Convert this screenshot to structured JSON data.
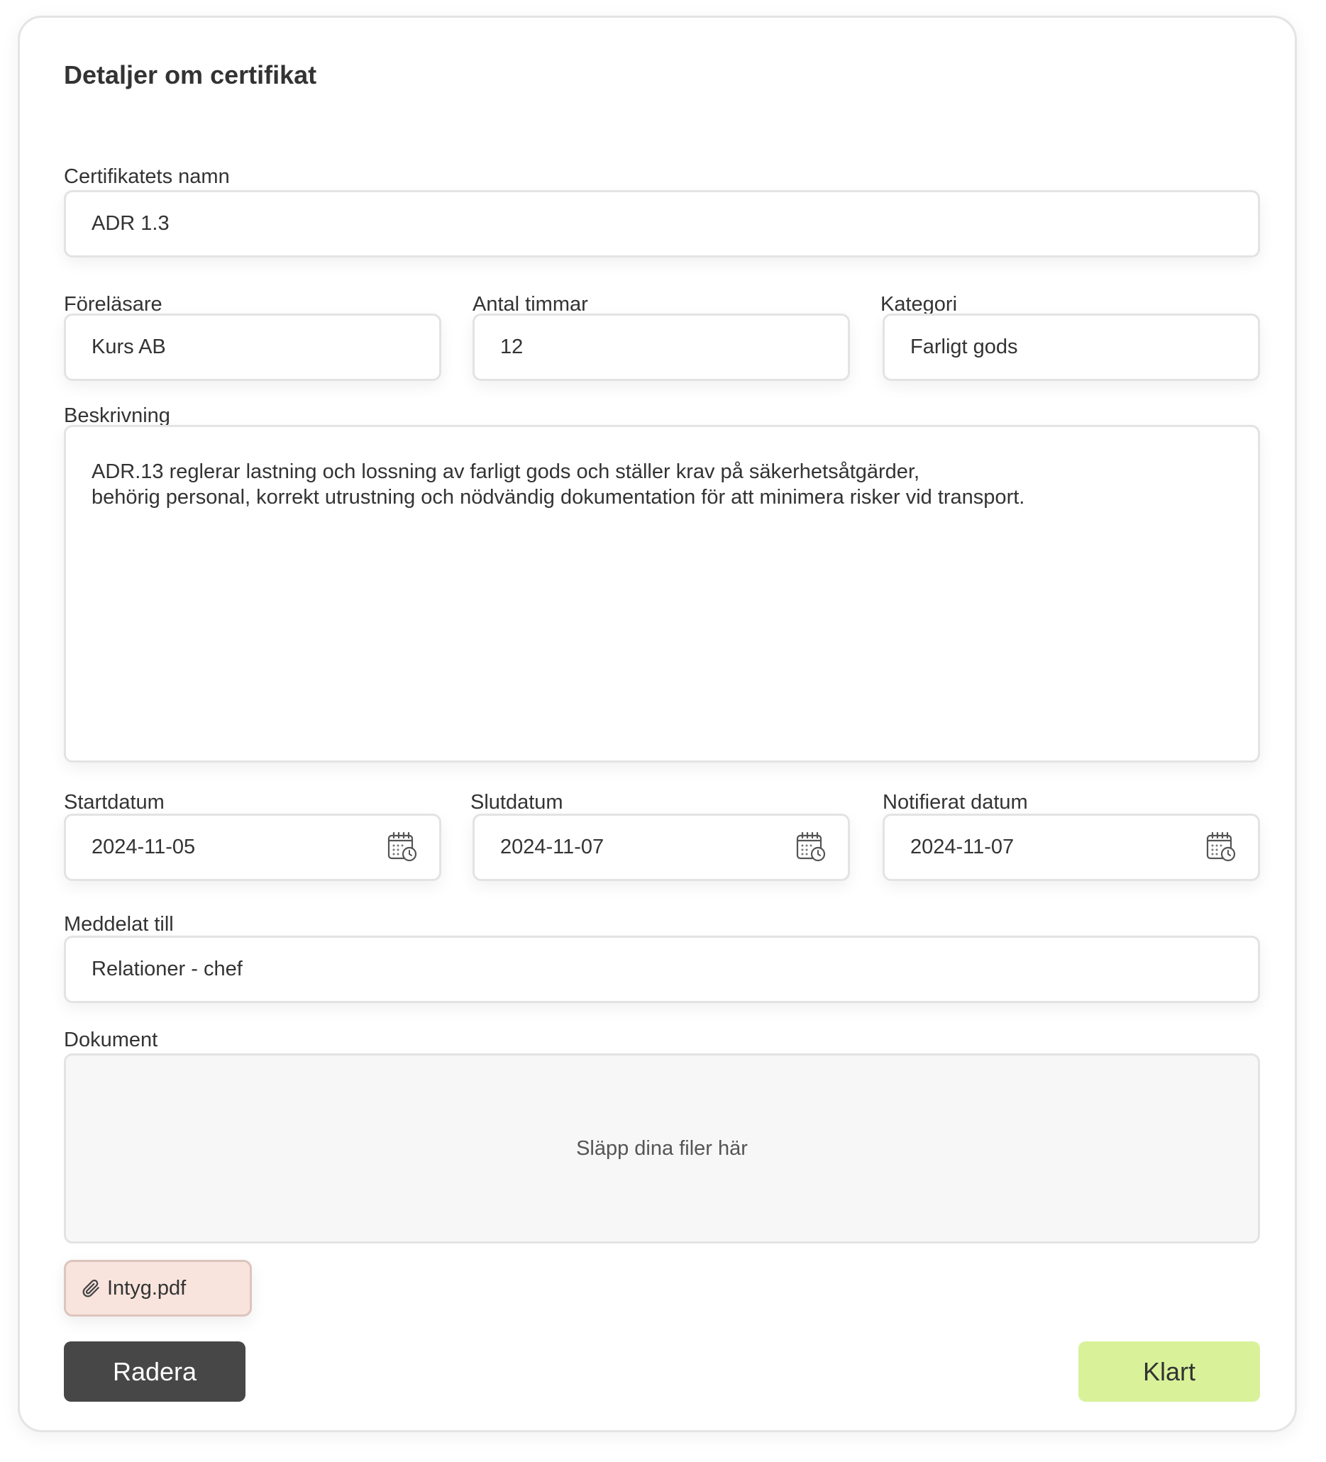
{
  "form": {
    "title": "Detaljer om certifikat",
    "name": {
      "label": "Certifikatets namn",
      "value": "ADR 1.3"
    },
    "lecturer": {
      "label": "Föreläsare",
      "value": "Kurs AB"
    },
    "hours": {
      "label": "Antal timmar",
      "value": "12"
    },
    "category": {
      "label": "Kategori",
      "value": "Farligt gods"
    },
    "description": {
      "label": "Beskrivning",
      "lines": [
        "ADR.13 reglerar lastning och lossning av farligt gods och ställer krav på säkerhetsåtgärder,",
        "behörig personal, korrekt utrustning och nödvändig dokumentation för att minimera risker vid transport."
      ]
    },
    "start_date": {
      "label": "Startdatum",
      "value": "2024-11-05",
      "icon": "calendar-clock-icon"
    },
    "end_date": {
      "label": "Slutdatum",
      "value": "2024-11-07",
      "icon": "calendar-clock-icon"
    },
    "notified_date": {
      "label": "Notifierat datum",
      "value": "2024-11-07",
      "icon": "calendar-clock-icon"
    },
    "notified_to": {
      "label": "Meddelat till",
      "value": "Relationer - chef"
    },
    "documents": {
      "label": "Dokument",
      "dropzone_text": "Släpp dina filer här",
      "files": [
        {
          "name": "Intyg.pdf",
          "icon": "paperclip-icon"
        }
      ]
    },
    "actions": {
      "delete_label": "Radera",
      "done_label": "Klart"
    }
  },
  "colors": {
    "delete_button": "#474747",
    "done_button": "#d9f29a",
    "file_chip": "#f8e4dd",
    "dropzone": "#f7f7f7",
    "field_border": "#e3e3e3"
  }
}
